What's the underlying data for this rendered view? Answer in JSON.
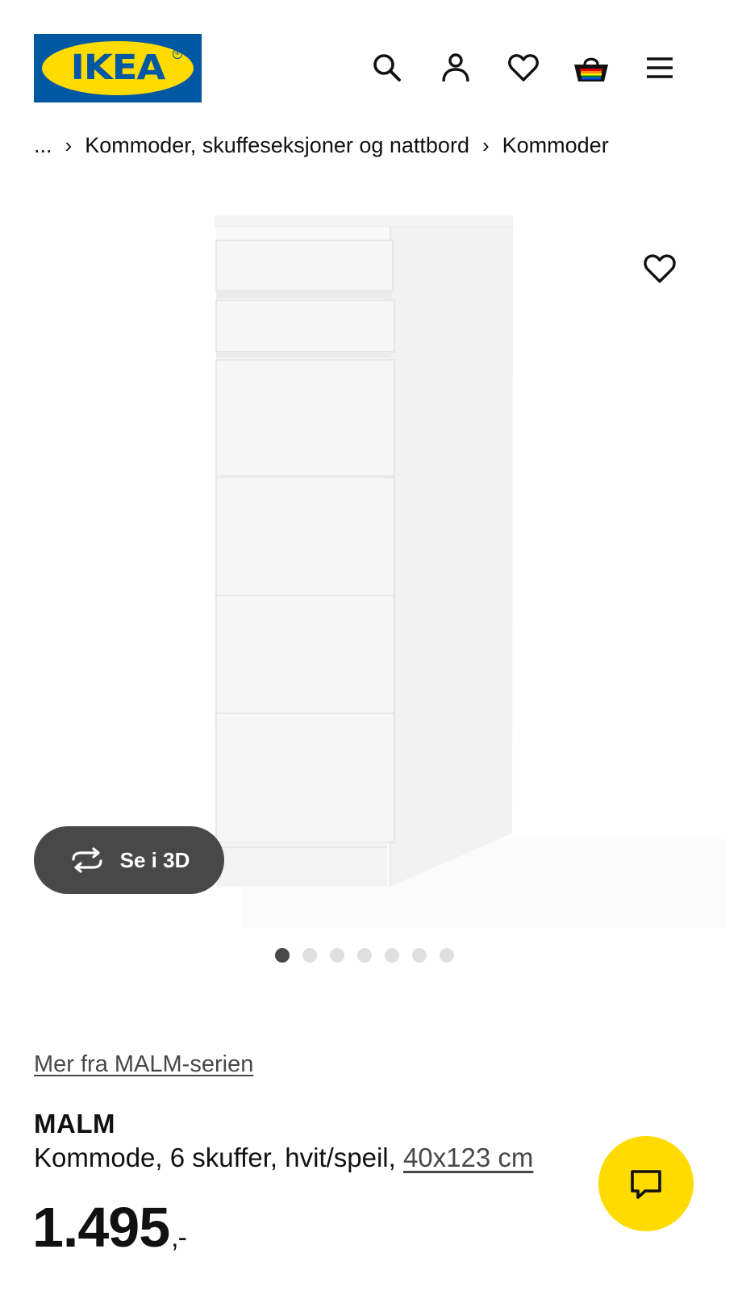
{
  "header": {
    "logo_text": "IKEA",
    "logo_reg": "®",
    "icons": {
      "search": "search-icon",
      "account": "account-icon",
      "favourites": "heart-icon",
      "basket": "basket-icon",
      "menu": "menu-icon"
    }
  },
  "breadcrumb": {
    "ellipsis": "...",
    "separator": "›",
    "items": [
      "Kommoder, skuffeseksjoner og nattbord",
      "Kommoder"
    ]
  },
  "gallery": {
    "view_3d_label": "Se i 3D",
    "dot_count": 7,
    "active_index": 0
  },
  "product": {
    "series_link": "Mer fra MALM-serien",
    "name": "MALM",
    "description": "Kommode, 6 skuffer, hvit/speil,",
    "size_link": "40x123 cm",
    "price": "1.495",
    "price_suffix": ",-"
  },
  "colors": {
    "ikea_blue": "#0058a3",
    "ikea_yellow": "#ffdb00",
    "dark_button": "#484848"
  }
}
